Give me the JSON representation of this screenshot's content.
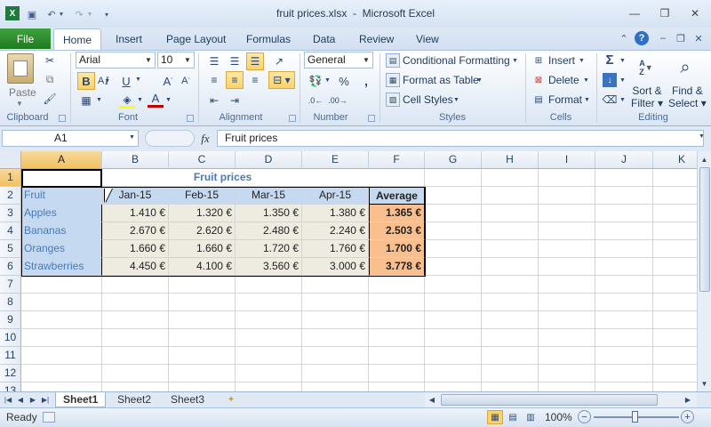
{
  "window": {
    "title": "fruit prices.xlsx  -  Microsoft Excel"
  },
  "ribbon_tabs": [
    "File",
    "Home",
    "Insert",
    "Page Layout",
    "Formulas",
    "Data",
    "Review",
    "View"
  ],
  "clipboard": {
    "paste_label": "Paste",
    "group_label": "Clipboard"
  },
  "font": {
    "name": "Arial",
    "size": "10",
    "group_label": "Font",
    "bold": "B",
    "italic": "I",
    "underline": "U",
    "color_letter": "A"
  },
  "alignment": {
    "group_label": "Alignment"
  },
  "number": {
    "format": "General",
    "group_label": "Number",
    "percent": "%"
  },
  "styles": {
    "conditional": "Conditional Formatting",
    "format_table": "Format as Table",
    "cell_styles": "Cell Styles",
    "group_label": "Styles"
  },
  "cells": {
    "insert": "Insert",
    "delete": "Delete",
    "format": "Format",
    "group_label": "Cells"
  },
  "editing": {
    "sort": "Sort &",
    "sort2": "Filter",
    "find": "Find &",
    "find2": "Select",
    "group_label": "Editing",
    "sum": "Σ"
  },
  "formula_bar": {
    "name_box": "A1",
    "fx": "fx",
    "content": "Fruit prices"
  },
  "columns": [
    "A",
    "B",
    "C",
    "D",
    "E",
    "F",
    "G",
    "H",
    "I",
    "J",
    "K"
  ],
  "rows": [
    "1",
    "2",
    "3",
    "4",
    "5",
    "6",
    "7",
    "8",
    "9",
    "10",
    "11",
    "12",
    "13"
  ],
  "sheet": {
    "title": "Fruit prices",
    "header": [
      "Fruit",
      "Jan-15",
      "Feb-15",
      "Mar-15",
      "Apr-15",
      "Average"
    ],
    "data": [
      [
        "Apples",
        "1.410 €",
        "1.320 €",
        "1.350 €",
        "1.380 €",
        "1.365 €"
      ],
      [
        "Bananas",
        "2.670 €",
        "2.620 €",
        "2.480 €",
        "2.240 €",
        "2.503 €"
      ],
      [
        "Oranges",
        "1.660 €",
        "1.660 €",
        "1.720 €",
        "1.760 €",
        "1.700 €"
      ],
      [
        "Strawberries",
        "4.450 €",
        "4.100 €",
        "3.560 €",
        "3.000 €",
        "3.778 €"
      ]
    ]
  },
  "sheet_tabs": [
    "Sheet1",
    "Sheet2",
    "Sheet3"
  ],
  "status": {
    "ready": "Ready",
    "zoom": "100%"
  },
  "colors": {
    "file_tab": "#2e8b2e",
    "fruit_fill": "#c5d9f1",
    "value_fill": "#eeece1",
    "average_fill": "#fabf8f"
  }
}
